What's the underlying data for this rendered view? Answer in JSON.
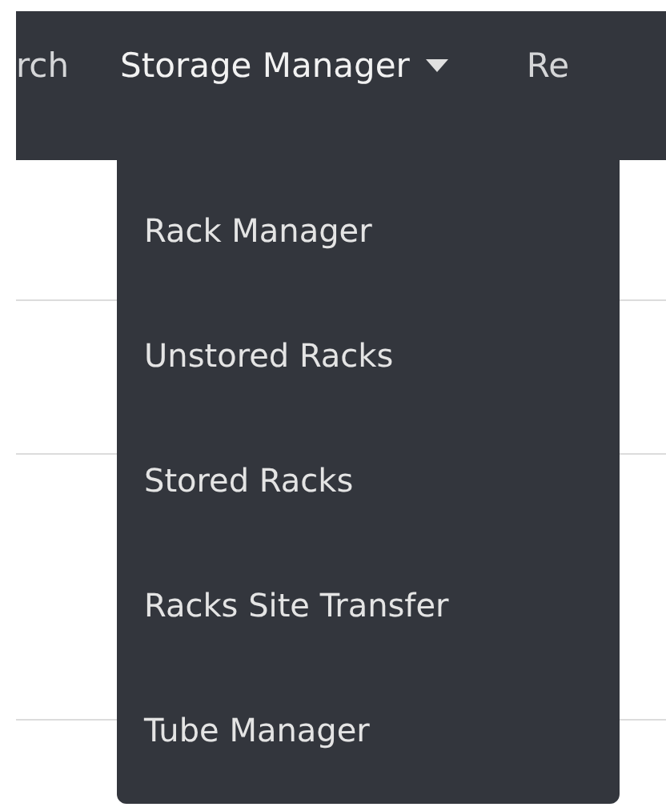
{
  "navbar": {
    "items": [
      {
        "label": "rch",
        "kind": "link"
      },
      {
        "label": "Storage Manager",
        "kind": "dropdown",
        "expanded": true
      },
      {
        "label": "Re",
        "kind": "link"
      }
    ]
  },
  "dropdown_menu": {
    "items": [
      {
        "label": "Rack Manager"
      },
      {
        "label": "Unstored Racks"
      },
      {
        "label": "Stored Racks"
      },
      {
        "label": "Racks Site Transfer"
      },
      {
        "label": "Tube Manager"
      }
    ]
  }
}
